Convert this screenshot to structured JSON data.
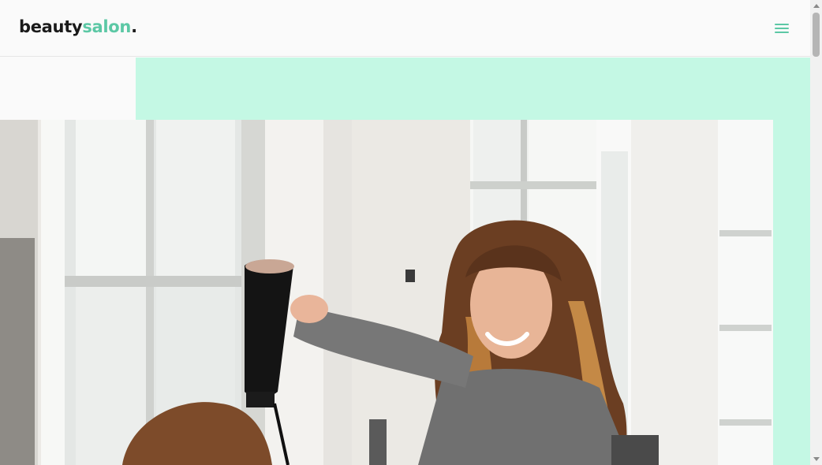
{
  "header": {
    "logo_part1": "beauty",
    "logo_part2": "salon",
    "logo_dot": "."
  },
  "icons": {
    "menu": "hamburger-menu-icon",
    "scroll_up": "triangle-up-icon",
    "scroll_down": "triangle-down-icon"
  },
  "colors": {
    "accent": "#5cc8a5",
    "mint_block": "#c4f8e4",
    "text_dark": "#1a1a1a",
    "page_bg": "#fafafa"
  }
}
